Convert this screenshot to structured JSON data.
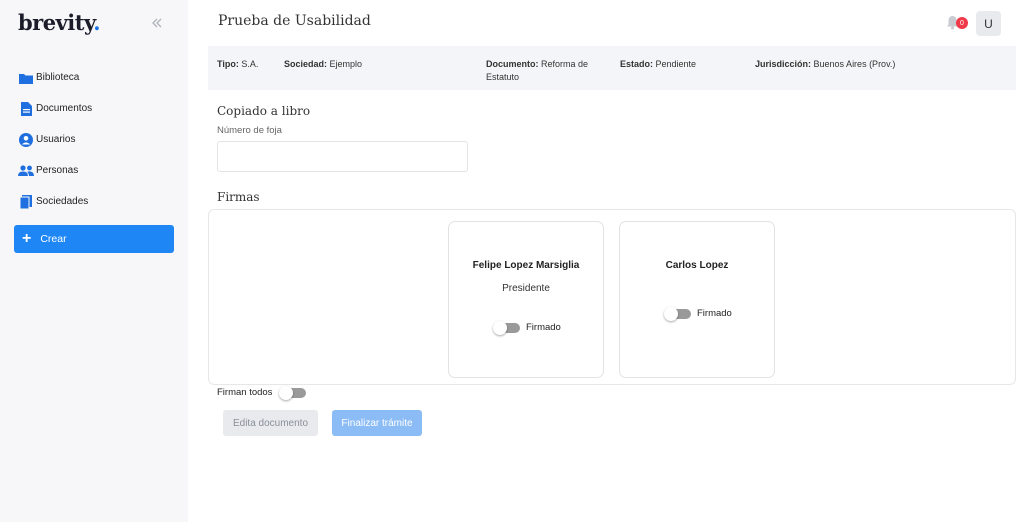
{
  "app": {
    "logo_text": "brevity",
    "logo_dot": "."
  },
  "sidebar": {
    "items": [
      {
        "label": "Biblioteca",
        "icon": "folder-icon"
      },
      {
        "label": "Documentos",
        "icon": "document-icon"
      },
      {
        "label": "Usuarios",
        "icon": "user-circle-icon"
      },
      {
        "label": "Personas",
        "icon": "people-icon"
      },
      {
        "label": "Sociedades",
        "icon": "building-icon"
      }
    ],
    "create_label": "Crear"
  },
  "header": {
    "title": "Prueba de Usabilidad",
    "notifications_count": "0",
    "avatar_initial": "U"
  },
  "info": {
    "tipo_label": "Tipo:",
    "tipo_value": "S.A.",
    "sociedad_label": "Sociedad:",
    "sociedad_value": "Ejemplo",
    "documento_label": "Documento:",
    "documento_value_1": "Reforma de",
    "documento_value_2": "Estatuto",
    "estado_label": "Estado:",
    "estado_value": "Pendiente",
    "jurisdiccion_label": "Jurisdicción:",
    "jurisdiccion_value": "Buenos Aires (Prov.)"
  },
  "copiado": {
    "title": "Copiado a libro",
    "field_label": "Número de foja",
    "field_value": ""
  },
  "firmas": {
    "title": "Firmas",
    "signers": [
      {
        "name": "Felipe Lopez Marsiglia",
        "role": "Presidente",
        "toggle_label": "Firmado",
        "signed": false
      },
      {
        "name": "Carlos Lopez",
        "role": "",
        "toggle_label": "Firmado",
        "signed": false
      }
    ],
    "firman_todos_label": "Firman todos",
    "firman_todos": false
  },
  "actions": {
    "edit_label": "Edita documento",
    "finish_label": "Finalizar trámite"
  },
  "colors": {
    "accent": "#1f87f5",
    "badge": "#f03a4a",
    "disabled_primary": "#8cbcf5"
  }
}
